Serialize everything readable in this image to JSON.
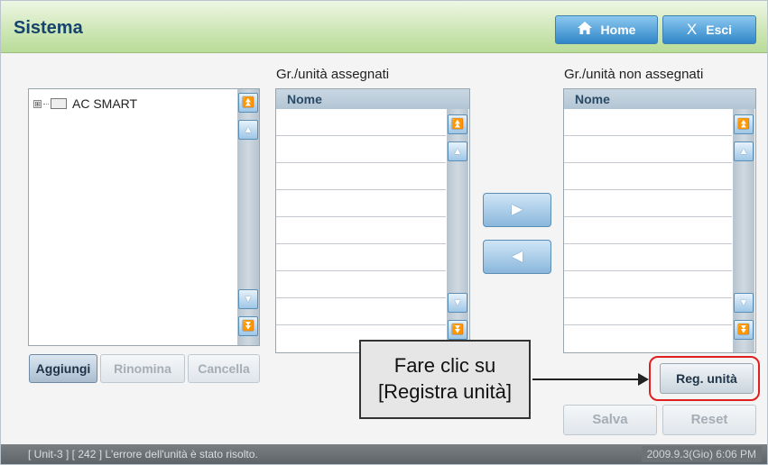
{
  "header": {
    "title": "Sistema",
    "home_label": "Home",
    "exit_label": "Esci",
    "home_icon": "home-icon",
    "exit_icon": "close-icon"
  },
  "tree": {
    "root_label": "AC SMART",
    "expander": "⊞"
  },
  "assigned": {
    "title": "Gr./unità assegnati",
    "column_header": "Nome",
    "rows": [
      "",
      "",
      "",
      "",
      "",
      "",
      "",
      "",
      ""
    ]
  },
  "unassigned": {
    "title": "Gr./unità non assegnati",
    "column_header": "Nome",
    "rows": [
      "",
      "",
      "",
      "",
      "",
      "",
      "",
      "",
      ""
    ]
  },
  "transfer": {
    "move_right": "▶",
    "move_left": "◀"
  },
  "tree_buttons": {
    "add": "Aggiungi",
    "rename": "Rinomina",
    "delete": "Cancella"
  },
  "actions": {
    "register_unit": "Reg. unità",
    "save": "Salva",
    "reset": "Reset"
  },
  "callout": {
    "line1": "Fare clic su",
    "line2": "[Registra unità]"
  },
  "status": {
    "message": "[ Unit-3 ] [ 242 ] L'errore dell'unità è stato risolto.",
    "datetime": "2009.9.3(Gio)  6:06 PM"
  },
  "colors": {
    "header_green": "#cfe7b8",
    "title_blue": "#15436c",
    "button_blue": "#2f86c8",
    "highlight_red": "#e02020"
  }
}
